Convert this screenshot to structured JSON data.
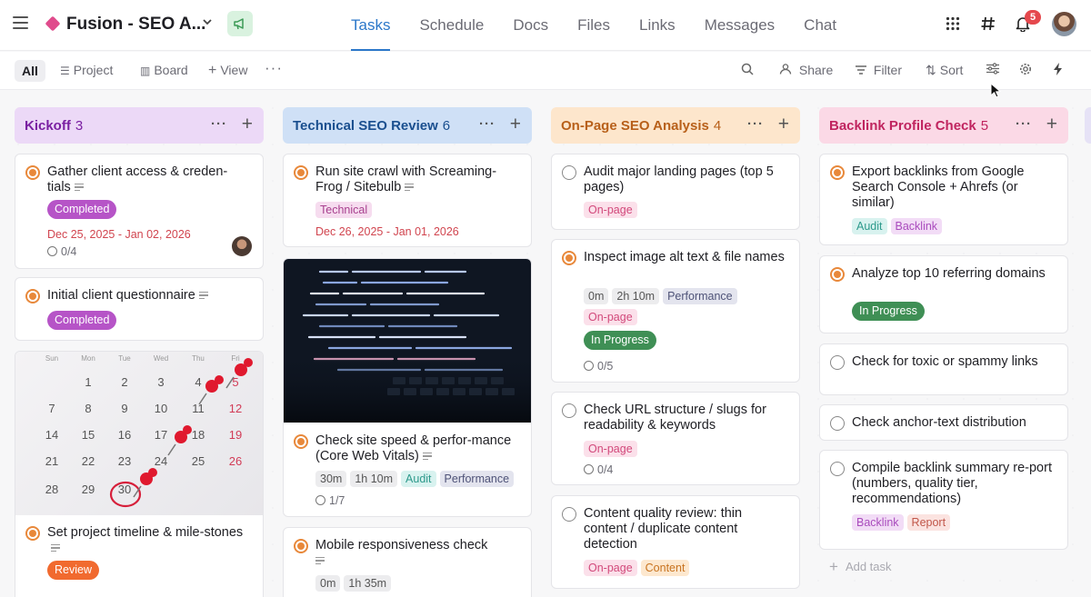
{
  "header": {
    "project_title": "Fusion - SEO A...",
    "tabs": [
      {
        "label": "Tasks",
        "active": true
      },
      {
        "label": "Schedule"
      },
      {
        "label": "Docs"
      },
      {
        "label": "Files"
      },
      {
        "label": "Links"
      },
      {
        "label": "Messages"
      },
      {
        "label": "Chat"
      }
    ],
    "notification_count": "5",
    "icons": [
      "menu-icon",
      "chevron-down-icon",
      "megaphone-icon",
      "apps-grid-icon",
      "hashtag-icon",
      "bell-icon",
      "avatar"
    ]
  },
  "toolbar": {
    "all_label": "All",
    "project_label": "Project",
    "board_label": "Board",
    "view_label": "View",
    "share_label": "Share",
    "filter_label": "Filter",
    "sort_label": "Sort"
  },
  "colors": {
    "accent": "#2b77c9",
    "completed": "#b654c7",
    "in_progress": "#3f8f55",
    "review": "#f16a2f",
    "date": "#d1454f"
  },
  "columns": [
    {
      "title": "Kickoff",
      "count": "3",
      "cards": [
        {
          "title": "Gather client access & creden-tials",
          "status": "Completed",
          "date": "Dec 25, 2025 - Jan 02, 2026",
          "subtasks": "0/4"
        },
        {
          "title": "Initial client questionnaire",
          "status": "Completed"
        },
        {
          "title": "Set project timeline & mile-stones",
          "status": "Review",
          "calendar": {
            "days": [
              "Sun",
              "Mon",
              "Tue",
              "Wed",
              "Thu",
              "Fri"
            ],
            "rows": [
              [
                "",
                "1",
                "2",
                "3",
                "4",
                "5"
              ],
              [
                "7",
                "8",
                "9",
                "10",
                "11",
                "12"
              ],
              [
                "14",
                "15",
                "16",
                "17",
                "18",
                "19"
              ],
              [
                "21",
                "22",
                "23",
                "24",
                "25",
                "26"
              ],
              [
                "28",
                "29",
                "30",
                "",
                "",
                ""
              ]
            ]
          }
        }
      ]
    },
    {
      "title": "Technical SEO Review",
      "count": "6",
      "cards": [
        {
          "title": "Run site crawl with Screaming-Frog / Sitebulb",
          "tags": [
            "Technical"
          ],
          "date": "Dec 26, 2025 - Jan 01, 2026"
        },
        {
          "title": "Check site speed & perfor-mance (Core Web Vitals)",
          "tags": [
            "30m",
            "1h 10m",
            "Audit",
            "Performance"
          ],
          "subtasks": "1/7"
        },
        {
          "title": "Mobile responsiveness check",
          "tags": [
            "0m",
            "1h 35m"
          ]
        }
      ]
    },
    {
      "title": "On-Page SEO Analysis",
      "count": "4",
      "cards": [
        {
          "title": "Audit major landing pages (top 5 pages)",
          "tags": [
            "On-page"
          ]
        },
        {
          "title": "Inspect image alt text & file names",
          "tags": [
            "0m",
            "2h 10m",
            "Performance"
          ],
          "tags2": [
            "On-page"
          ],
          "status": "In Progress",
          "subtasks": "0/5"
        },
        {
          "title": "Check URL structure / slugs for readability & keywords",
          "tags": [
            "On-page"
          ],
          "subtasks": "0/4"
        },
        {
          "title": "Content quality review: thin content / duplicate content detection",
          "tags": [
            "On-page",
            "Content"
          ]
        }
      ]
    },
    {
      "title": "Backlink Profile Check",
      "count": "5",
      "cards": [
        {
          "title": "Export backlinks from Google Search Console + Ahrefs (or similar)",
          "tags": [
            "Audit",
            "Backlink"
          ]
        },
        {
          "title": "Analyze top 10 referring domains",
          "status": "In Progress"
        },
        {
          "title": "Check for toxic or spammy links"
        },
        {
          "title": "Check anchor-text distribution"
        },
        {
          "title": "Compile backlink summary re-port (numbers, quality tier, recommendations)",
          "tags": [
            "Backlink",
            "Report"
          ]
        }
      ],
      "add_task_label": "Add task"
    }
  ]
}
